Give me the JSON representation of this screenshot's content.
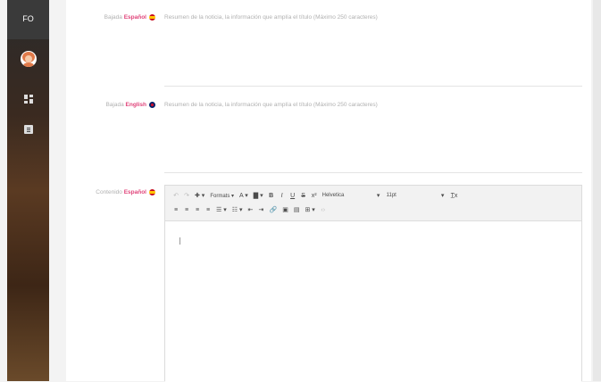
{
  "sidebar": {
    "initials": "FO",
    "icons": [
      "avatar",
      "dashboard-icon",
      "document-icon"
    ]
  },
  "fields": [
    {
      "label_prefix": "Bajada",
      "lang": "Español",
      "flag": "es",
      "placeholder": "Resumen de la noticia, la información que amplía el título (Máximo 250 caracteres)"
    },
    {
      "label_prefix": "Bajada",
      "lang": "English",
      "flag": "en",
      "placeholder": "Resumen de la noticia, la información que amplía el título (Máximo 250 caracteres)"
    }
  ],
  "content_field": {
    "label_prefix": "Contenido",
    "lang": "Español",
    "flag": "es"
  },
  "toolbar": {
    "row1": [
      "↶",
      "↷",
      "✚ ▾",
      "Formats ▾",
      "A ▾",
      "▇ ▾",
      "B",
      "I",
      "U",
      "S",
      "x²",
      "Helvetica",
      "▾",
      "11pt",
      "▾",
      "T̲x"
    ],
    "font_family": "Helvetica",
    "font_size": "11pt",
    "formats_label": "Formats",
    "row2": [
      "≡",
      "≡",
      "≡",
      "≡",
      "☰ ▾",
      "☷ ▾",
      "⇤",
      "⇥",
      "🔗",
      "▣",
      "▤",
      "⊞ ▾",
      "‹›"
    ]
  }
}
